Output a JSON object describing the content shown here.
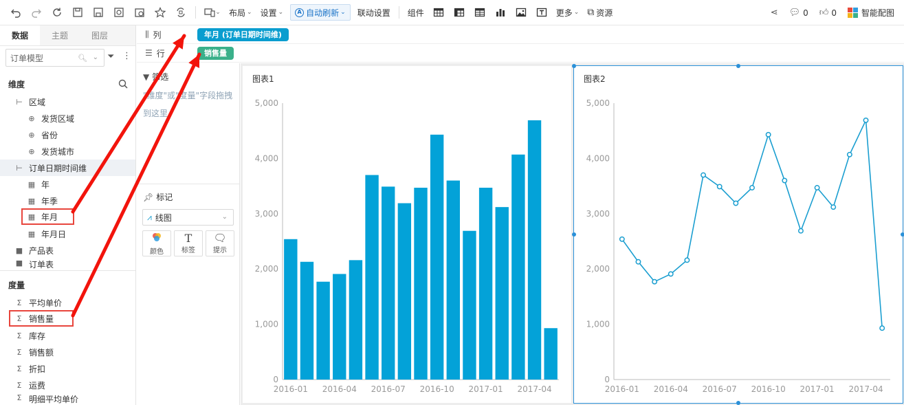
{
  "toolbar": {
    "layout": "布局",
    "settings": "设置",
    "auto_refresh": "自动刷新",
    "link_settings": "联动设置",
    "components": "组件",
    "more": "更多",
    "resources": "资源",
    "comment_count": "0",
    "like_count": "0",
    "smart_chart": "智能配图"
  },
  "left": {
    "tabs": [
      "数据",
      "主题",
      "图层"
    ],
    "model": "订单模型",
    "dimensions_title": "维度",
    "measures_title": "度量",
    "dimensions": [
      "区域",
      "发货区域",
      "省份",
      "发货城市",
      "订单日期时间维",
      "年",
      "年季",
      "年月",
      "年月日",
      "产品表",
      "订单表"
    ],
    "measures": [
      "平均单价",
      "销售量",
      "库存",
      "销售额",
      "折扣",
      "运费",
      "明细平均单价"
    ]
  },
  "shelves": {
    "columns_label": "列",
    "rows_label": "行",
    "column_pill": "年月 (订单日期时间维)",
    "row_pill": "销售量"
  },
  "middle": {
    "filter_title": "筛选",
    "filter_hint": "\"维度\"或\"度量\"字段拖拽到这里",
    "marks_title": "标记",
    "mark_type": "线图",
    "buttons": [
      "颜色",
      "标签",
      "提示"
    ]
  },
  "colors": {
    "bar": "#03a2d8",
    "line": "#1a9ed0",
    "arrow": "#f2140c",
    "highlight": "#e8453c"
  },
  "chart_data": [
    {
      "type": "bar",
      "title": "图表1",
      "categories": [
        "2016-01",
        "2016-02",
        "2016-03",
        "2016-04",
        "2016-05",
        "2016-06",
        "2016-07",
        "2016-08",
        "2016-09",
        "2016-10",
        "2016-11",
        "2016-12",
        "2017-01",
        "2017-02",
        "2017-03",
        "2017-04",
        "2017-05"
      ],
      "values": [
        2540,
        2130,
        1770,
        1910,
        2160,
        3700,
        3490,
        3190,
        3470,
        4430,
        3600,
        2690,
        3470,
        3120,
        4070,
        4690,
        930
      ],
      "x_tick_labels": [
        "2016-01",
        "2016-04",
        "2016-07",
        "2016-10",
        "2017-01",
        "2017-04"
      ],
      "y_tick_labels": [
        "0",
        "1,000",
        "2,000",
        "3,000",
        "4,000",
        "5,000"
      ],
      "ylim": [
        0,
        5000
      ],
      "grid": false
    },
    {
      "type": "line",
      "title": "图表2",
      "categories": [
        "2016-01",
        "2016-02",
        "2016-03",
        "2016-04",
        "2016-05",
        "2016-06",
        "2016-07",
        "2016-08",
        "2016-09",
        "2016-10",
        "2016-11",
        "2016-12",
        "2017-01",
        "2017-02",
        "2017-03",
        "2017-04",
        "2017-05"
      ],
      "values": [
        2540,
        2130,
        1770,
        1910,
        2160,
        3700,
        3490,
        3190,
        3470,
        4430,
        3600,
        2690,
        3470,
        3120,
        4070,
        4690,
        930
      ],
      "x_tick_labels": [
        "2016-01",
        "2016-04",
        "2016-07",
        "2016-10",
        "2017-01",
        "2017-04"
      ],
      "y_tick_labels": [
        "0",
        "1,000",
        "2,000",
        "3,000",
        "4,000",
        "5,000"
      ],
      "ylim": [
        0,
        5000
      ],
      "grid": false
    }
  ]
}
